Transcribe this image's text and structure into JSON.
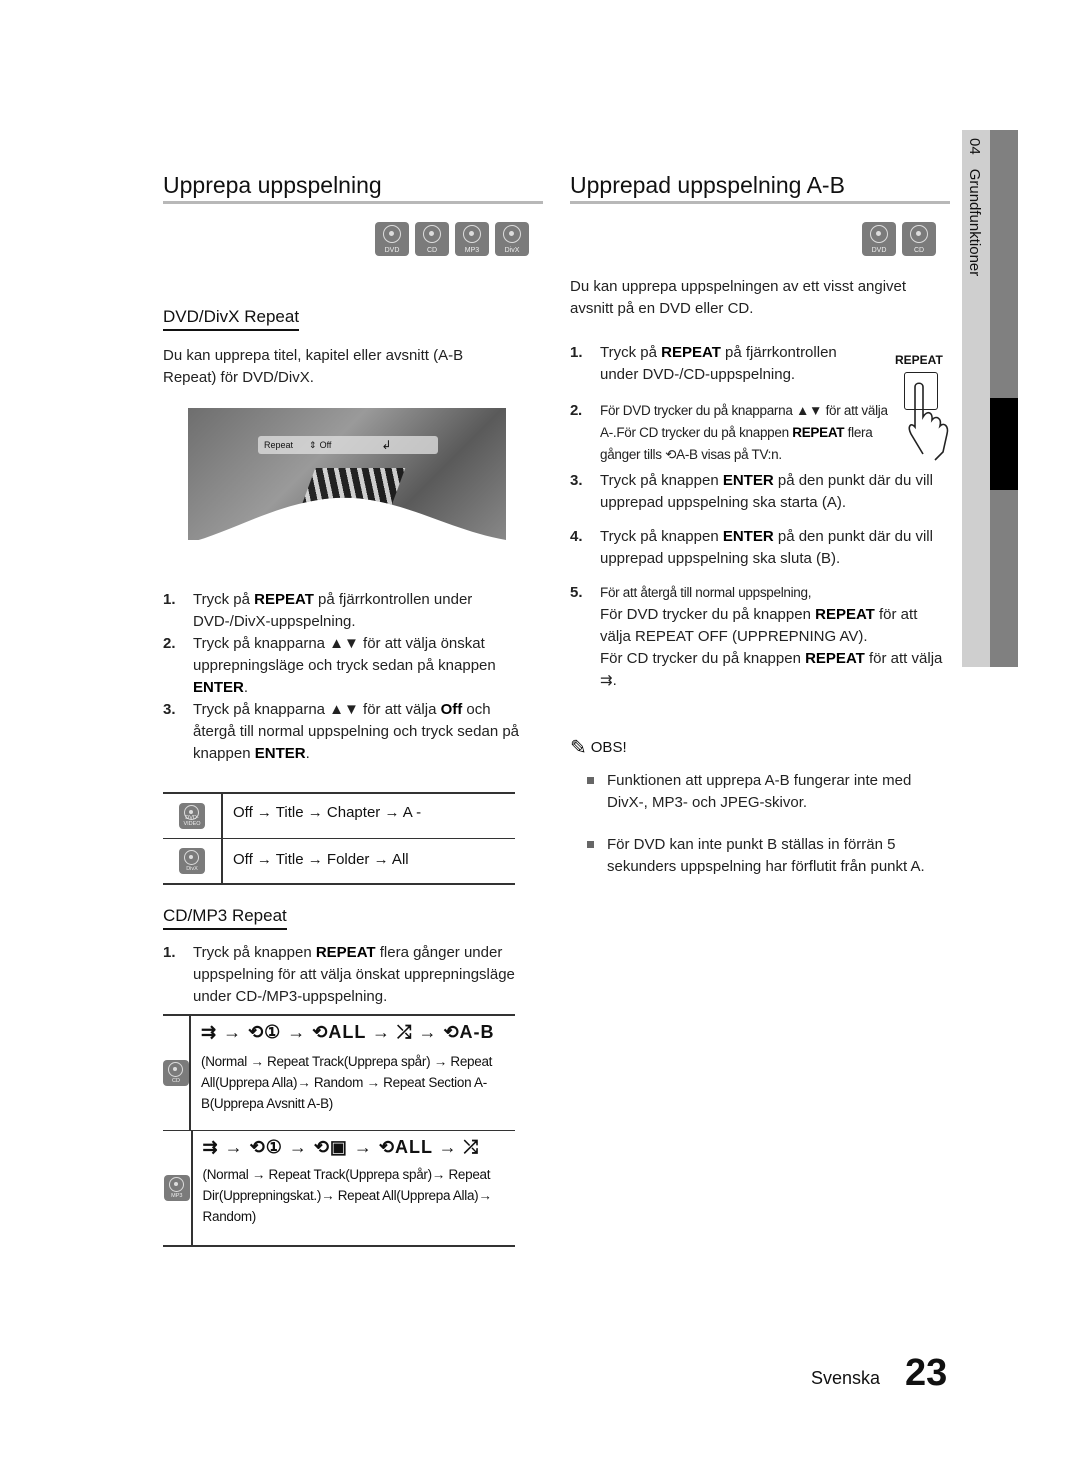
{
  "left": {
    "title": "Upprepa uppspelning",
    "disc_icons": [
      "DVD",
      "CD",
      "MP3",
      "DivX"
    ],
    "dvd_divx": {
      "heading": "DVD/DivX Repeat",
      "intro": "Du kan upprepa titel, kapitel eller avsnitt (A-B Repeat) för DVD/DivX.",
      "osd": {
        "label": "Repeat",
        "updown": "⇕",
        "value": "Off",
        "enter_icon": "↲"
      },
      "steps": [
        {
          "num": "1.",
          "pre": "Tryck på ",
          "bold": "REPEAT",
          "post": " på fjärrkontrollen under DVD-/DivX-uppspelning."
        },
        {
          "num": "2.",
          "pre": "Tryck på knapparna ▲▼ för att välja önskat upprepningsläge och tryck sedan på knappen ",
          "bold": "ENTER",
          "post": "."
        },
        {
          "num": "3.",
          "pre": "Tryck på knapparna ▲▼ för att välja ",
          "bold": "Off",
          "post": " och återgå till normal uppspelning och tryck sedan på knappen ",
          "bold2": "ENTER",
          "post2": "."
        }
      ],
      "table": [
        {
          "icon": "DVD-VIDEO",
          "text": "Off → Title → Chapter → A -"
        },
        {
          "icon": "DivX",
          "text": "Off → Title → Folder → All"
        }
      ]
    },
    "cd_mp3": {
      "heading": "CD/MP3 Repeat",
      "steps": [
        {
          "num": "1.",
          "pre": "Tryck på knappen ",
          "bold": "REPEAT",
          "post": " flera gånger under uppspelning för att välja önskat upprepningsläge under CD-/MP3-uppspelning."
        }
      ],
      "table": [
        {
          "icon": "CD",
          "modes": "⇉ → ⟲① → ⟲ALL → ⤮ → ⟲A-B",
          "text": "(Normal → Repeat Track(Upprepa spår) → Repeat All(Upprepa Alla)→ Random → Repeat Section A-B(Upprepa Avsnitt A-B)"
        },
        {
          "icon": "MP3",
          "modes": "⇉ → ⟲① → ⟲▣ → ⟲ALL → ⤮",
          "text": "(Normal  → Repeat Track(Upprepa spår)→ Repeat Dir(Upprepningskat.)→ Repeat All(Upprepa Alla)→ Random)"
        }
      ]
    }
  },
  "right": {
    "title": "Upprepad uppspelning A-B",
    "disc_icons": [
      "DVD",
      "CD"
    ],
    "intro": "Du kan upprepa uppspelningen av ett visst angivet avsnitt på en DVD eller CD.",
    "remote_label": "REPEAT",
    "steps": [
      {
        "num": "1.",
        "pre": "Tryck på ",
        "bold": "REPEAT",
        "post": " på fjärrkontrollen under DVD-/CD-uppspelning."
      },
      {
        "num": "2.",
        "pre": "För DVD trycker du på knapparna ▲▼ för att välja A-.För CD trycker du på knappen ",
        "bold": "REPEAT",
        "post": " flera gånger tills ⟲A-B visas på TV:n."
      },
      {
        "num": "3.",
        "pre": "Tryck på knappen ",
        "bold": "ENTER",
        "post": " på den punkt där du vill upprepad uppspelning ska starta (A)."
      },
      {
        "num": "4.",
        "pre": "Tryck på knappen ",
        "bold": "ENTER",
        "post": " på den punkt där du vill upprepad uppspelning ska sluta (B)."
      },
      {
        "num": "5.",
        "pre": "För att återgå till normal uppspelning,",
        "line2pre": "För DVD trycker du på knappen ",
        "line2bold": "REPEAT",
        "line2post": " för att välja REPEAT OFF (UPPREPNING AV).",
        "line3pre": "För CD trycker du på knappen ",
        "line3bold": "REPEAT",
        "line3post": " för att välja ⇉."
      }
    ],
    "note_title": "OBS!",
    "notes": [
      "Funktionen att upprepa A-B fungerar inte med DivX-, MP3- och JPEG-skivor.",
      "För DVD kan inte punkt B ställas in förrän 5 sekunders uppspelning har förflutit från punkt A."
    ]
  },
  "side_tab": {
    "chapter": "04",
    "label": "Grundfunktioner"
  },
  "footer": {
    "language": "Svenska",
    "page": "23"
  }
}
